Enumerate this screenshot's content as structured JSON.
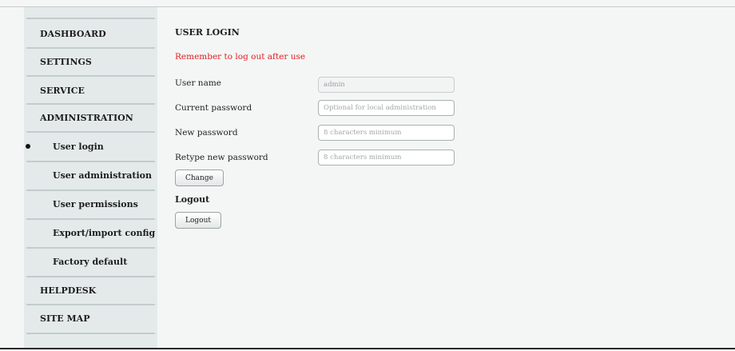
{
  "sidebar": {
    "items": [
      {
        "label": "DASHBOARD"
      },
      {
        "label": "SETTINGS"
      },
      {
        "label": "SERVICE"
      },
      {
        "label": "ADMINISTRATION"
      },
      {
        "label": "User login",
        "active": true
      },
      {
        "label": "User administration"
      },
      {
        "label": "User permissions"
      },
      {
        "label": "Export/import config"
      },
      {
        "label": "Factory default"
      },
      {
        "label": "HELPDESK"
      },
      {
        "label": "SITE MAP"
      }
    ]
  },
  "main": {
    "title": "USER LOGIN",
    "warning": "Remember to log out after use",
    "fields": [
      {
        "label": "User name",
        "value": "admin",
        "placeholder": "",
        "disabled": true
      },
      {
        "label": "Current password",
        "value": "",
        "placeholder": "Optional for local administration"
      },
      {
        "label": "New password",
        "value": "",
        "placeholder": "8 characters minimum"
      },
      {
        "label": "Retype new password",
        "value": "",
        "placeholder": "8 characters minimum"
      }
    ],
    "change_button": "Change",
    "logout_heading": "Logout",
    "logout_button": "Logout"
  },
  "colors": {
    "warning": "#e02020",
    "sidebar_bg": "#e4eaea",
    "page_bg": "#f4f6f6"
  }
}
